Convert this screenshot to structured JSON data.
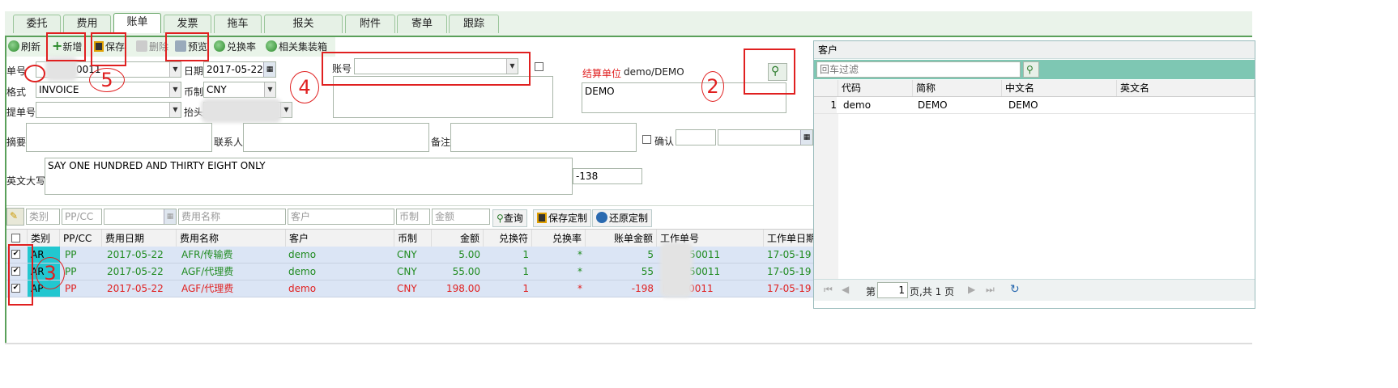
{
  "tabs": [
    "委托",
    "费用",
    "账单",
    "发票",
    "拖车",
    "报关",
    "附件",
    "寄单",
    "跟踪"
  ],
  "toolbar": {
    "refresh": "刷新",
    "add": "新增",
    "save": "保存",
    "delete": "删除",
    "preview": "预览",
    "exchange": "兑换率",
    "container": "相关集装箱"
  },
  "form": {
    "doc_no_label": "单号",
    "doc_no_value": "0011",
    "date_label": "日期",
    "date_value": "2017-05-22",
    "format_label": "格式",
    "format_value": "INVOICE",
    "currency_label": "币制",
    "currency_value": "CNY",
    "bl_label": "提单号",
    "bl_value": "",
    "header_label": "抬头",
    "account_label": "账号",
    "account_value": "",
    "settle_label": "结算单位",
    "settle_value": "demo/DEMO",
    "settle_name": "DEMO",
    "summary_label": "摘要",
    "contact_label": "联系人",
    "remark_label": "备注",
    "confirm_label": "确认",
    "english_label": "英文大写",
    "english_value": "SAY ONE HUNDRED AND THIRTY EIGHT ONLY",
    "total_value": "-138"
  },
  "annotations": [
    "5",
    "4",
    "2",
    "3"
  ],
  "filter": {
    "category": "类别",
    "ppcc": "PP/CC",
    "fee_name": "费用名称",
    "customer": "客户",
    "currency": "币制",
    "amount": "金额",
    "query": "查询",
    "save_custom": "保存定制",
    "restore_custom": "还原定制"
  },
  "grid": {
    "columns": [
      "类别",
      "PP/CC",
      "费用日期",
      "费用名称",
      "客户",
      "币制",
      "金额",
      "兑换符",
      "兑换率",
      "账单金额",
      "工作单号",
      "工作单日期"
    ],
    "rows": [
      {
        "cat": "AR",
        "ppcc": "PP",
        "date": "2017-05-22",
        "fee": "AFR/传输费",
        "customer": "demo",
        "cur": "CNY",
        "amount": "5.00",
        "sign": "1",
        "rate": "*",
        "bill": "5",
        "job": "50011",
        "jobdate": "17-05-19",
        "color": "#1e8a1e"
      },
      {
        "cat": "AR",
        "ppcc": "PP",
        "date": "2017-05-22",
        "fee": "AGF/代理费",
        "customer": "demo",
        "cur": "CNY",
        "amount": "55.00",
        "sign": "1",
        "rate": "*",
        "bill": "55",
        "job": "50011",
        "jobdate": "17-05-19",
        "color": "#1e8a1e"
      },
      {
        "cat": "AP",
        "ppcc": "PP",
        "date": "2017-05-22",
        "fee": "AGF/代理费",
        "customer": "demo",
        "cur": "CNY",
        "amount": "198.00",
        "sign": "1",
        "rate": "*",
        "bill": "-198",
        "job": "P...050011",
        "jobdate": "17-05-19",
        "color": "#e02020"
      }
    ]
  },
  "customer_panel": {
    "title": "客户",
    "filter_placeholder": "回车过滤",
    "columns": [
      "代码",
      "简称",
      "中文名",
      "英文名"
    ],
    "rows": [
      {
        "no": "1",
        "code": "demo",
        "short": "DEMO",
        "cn": "DEMO",
        "en": ""
      }
    ],
    "pager": {
      "page_label": "第",
      "page_value": "1",
      "total": "页,共 1 页"
    }
  }
}
